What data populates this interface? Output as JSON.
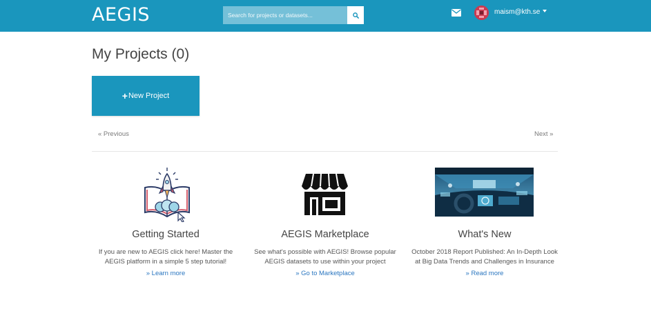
{
  "header": {
    "logo": "AEGIS",
    "search_placeholder": "Search for projects or datasets...",
    "user_email": "maism@kth.se"
  },
  "icons": {
    "search": "search-icon",
    "mail": "envelope-icon",
    "user_menu": "chevron-down-icon",
    "new_project": "plus-icon"
  },
  "colors": {
    "brand": "#1a96bd",
    "link": "#2a76c0"
  },
  "main": {
    "title": "My Projects (0)",
    "new_project_label": "New Project",
    "pagination": {
      "previous": "« Previous",
      "next": "Next »"
    }
  },
  "cards": [
    {
      "icon": "rocket-book-icon",
      "title": "Getting Started",
      "description": "If you are new to AEGIS click here! Master the AEGIS platform in a simple 5 step tutorial!",
      "link": "» Learn more"
    },
    {
      "icon": "storefront-icon",
      "title": "AEGIS Marketplace",
      "description": "See what's possible with AEGIS! Browse popular AEGIS datasets to use within your project",
      "link": "» Go to Marketplace"
    },
    {
      "icon": "car-dashboard-image",
      "title": "What's New",
      "description": "October 2018 Report Published: An In-Depth Look at Big Data Trends and Challenges in Insurance",
      "link": "» Read more"
    }
  ]
}
